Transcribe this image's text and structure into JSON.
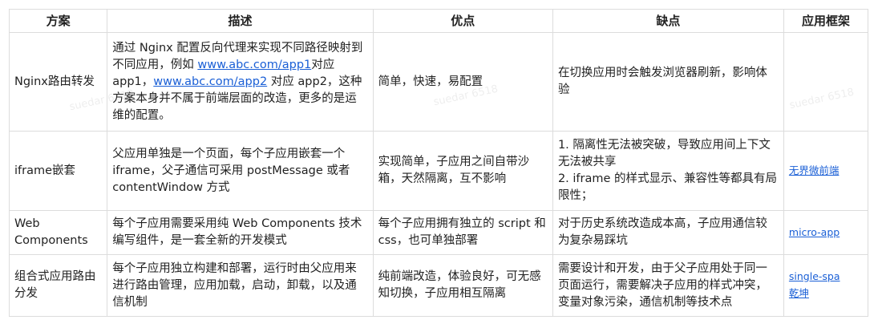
{
  "headers": [
    "方案",
    "描述",
    "优点",
    "缺点",
    "应用框架"
  ],
  "rows": [
    {
      "name": "Nginx路由转发",
      "desc": {
        "p1": "通过 Nginx 配置反向代理来实现不同路径映射到不同应用，例如 ",
        "link1": "www.abc.com/app1",
        "p2": "对应app1，",
        "link2": "www.abc.com/app2",
        "p3": " 对应 app2，这种方案本身并不属于前端层面的改造，更多的是运维的配置。"
      },
      "pros": "简单，快速，易配置",
      "cons": "在切换应用时会触发浏览器刷新，影响体验",
      "framework": ""
    },
    {
      "name": "iframe嵌套",
      "desc": "父应用单独是一个页面，每个子应用嵌套一个iframe，父子通信可采用 postMessage 或者 contentWindow 方式",
      "pros": "实现简单，子应用之间自带沙箱，天然隔离，互不影响",
      "cons_list": [
        "1. 隔离性无法被突破，导致应用间上下文无法被共享",
        "2. iframe 的样式显示、兼容性等都具有局限性；"
      ],
      "framework": "无界微前端"
    },
    {
      "name": "Web Components",
      "desc": "每个子应用需要采用纯 Web Components 技术编写组件，是一套全新的开发模式",
      "pros": "每个子应用拥有独立的 script 和 css，也可单独部署",
      "cons": "对于历史系统改造成本高，子应用通信较为复杂易踩坑",
      "framework": "micro-app"
    },
    {
      "name": "组合式应用路由分发",
      "desc": "每个子应用独立构建和部署，运行时由父应用来进行路由管理，应用加载，启动，卸载，以及通信机制",
      "pros": "纯前端改造，体验良好，可无感知切换，子应用相互隔离",
      "cons": "需要设计和开发，由于父子应用处于同一页面运行，需要解决子应用的样式冲突，变量对象污染，通信机制等技术点",
      "framework_list": [
        "single-spa",
        "乾坤"
      ]
    }
  ],
  "watermark": "suedar 6518",
  "colors": {
    "link": "#1a5fd6",
    "border": "#dcdcdc"
  }
}
